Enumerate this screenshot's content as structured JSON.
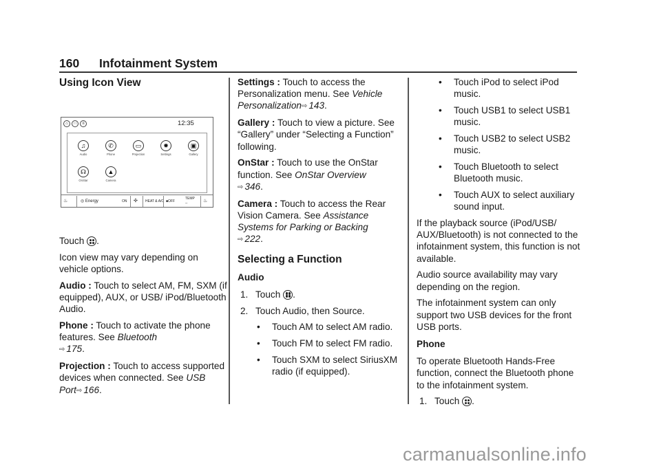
{
  "header": {
    "page_number": "160",
    "section_title": "Infotainment System"
  },
  "col1": {
    "heading": "Using Icon View",
    "screen": {
      "clock": "12:35",
      "top_icons": [
        "home-icon",
        "apps-icon",
        "favorites-icon"
      ],
      "apps": [
        {
          "label": "Audio",
          "icon": "music-note-icon",
          "glyph": "♫"
        },
        {
          "label": "Phone",
          "icon": "phone-icon",
          "glyph": "✆"
        },
        {
          "label": "Projection",
          "icon": "projection-icon",
          "glyph": "▭"
        },
        {
          "label": "Settings",
          "icon": "gear-icon",
          "glyph": "✹"
        },
        {
          "label": "Gallery",
          "icon": "gallery-icon",
          "glyph": "▣"
        },
        {
          "label": "OnStar",
          "icon": "onstar-icon",
          "glyph": "☊"
        },
        {
          "label": "Camera",
          "icon": "camera-icon",
          "glyph": "▲"
        }
      ],
      "climate": {
        "energy": "Energy",
        "on": "ON",
        "heat_ac": "HEAT & A/C",
        "off": "OFF",
        "temp": "TEMP",
        "temp_value": "--"
      }
    },
    "touch_line": "Touch",
    "icon_view_note": "Icon view may vary depending on vehicle options.",
    "audio": {
      "term": "Audio :",
      "text": "Touch to select AM, FM, SXM (if equipped), AUX, or USB/ iPod/Bluetooth Audio."
    },
    "phone": {
      "term": "Phone :",
      "text": "Touch to activate the phone features. See",
      "ref": "Bluetooth",
      "page": "175",
      "end": "."
    },
    "projection": {
      "term": "Projection :",
      "text": "Touch to access supported devices when connected. See",
      "ref": "USB Port",
      "page": "166",
      "end": "."
    }
  },
  "col2": {
    "settings": {
      "term": "Settings :",
      "text": "Touch to access the Personalization menu. See",
      "ref": "Vehicle Personalization",
      "page": "143",
      "end": "."
    },
    "gallery": {
      "term": "Gallery :",
      "text": "Touch to view a picture. See “Gallery” under “Selecting a Function” following."
    },
    "onstar": {
      "term": "OnStar :",
      "text": "Touch to use the OnStar function. See",
      "ref": "OnStar Overview",
      "page": "346",
      "end": "."
    },
    "camera": {
      "term": "Camera :",
      "text": "Touch to access the Rear Vision Camera. See",
      "ref": "Assistance Systems for Parking or Backing",
      "page": "222",
      "end": "."
    },
    "heading": "Selecting a Function",
    "subheading": "Audio",
    "steps": [
      {
        "num": "1.",
        "text": "Touch"
      },
      {
        "num": "2.",
        "text": "Touch Audio, then Source."
      }
    ],
    "bullets": [
      "Touch AM to select AM radio.",
      "Touch FM to select FM radio.",
      "Touch SXM to select SiriusXM radio (if equipped)."
    ]
  },
  "col3": {
    "bullets": [
      "Touch iPod to select iPod music.",
      "Touch USB1 to select USB1 music.",
      "Touch USB2 to select USB2 music.",
      "Touch Bluetooth to select Bluetooth music.",
      "Touch AUX to select auxiliary sound input."
    ],
    "para1": "If the playback source (iPod/USB/ AUX/Bluetooth) is not connected to the infotainment system, this function is not available.",
    "para2": "Audio source availability may vary depending on the region.",
    "para3": "The infotainment system can only support two USB devices for the front USB ports.",
    "subheading": "Phone",
    "para4": "To operate Bluetooth Hands-Free function, connect the Bluetooth phone to the infotainment system.",
    "steps": [
      {
        "num": "1.",
        "text": "Touch"
      }
    ]
  },
  "footer": {
    "watermark": "carmanualsonline.info"
  },
  "symbols": {
    "page_arrow": "⇨",
    "bullet": "•",
    "period": "."
  }
}
